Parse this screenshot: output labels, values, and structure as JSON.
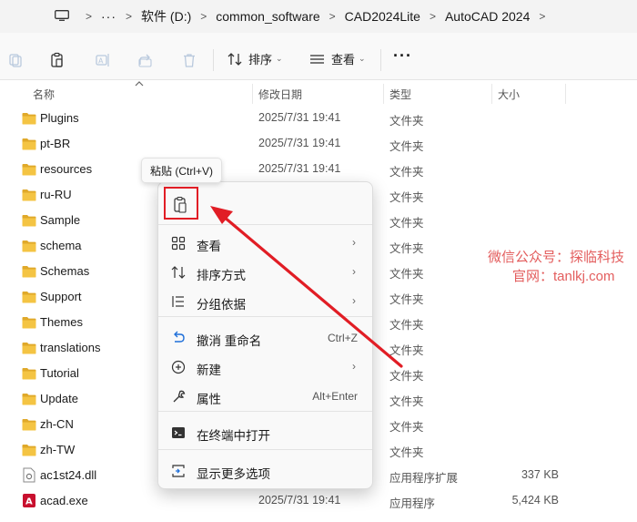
{
  "breadcrumb": {
    "overflow": "···",
    "items": [
      "软件 (D:)",
      "common_software",
      "CAD2024Lite",
      "AutoCAD 2024"
    ],
    "sep": ">"
  },
  "toolbar": {
    "sort_label": "排序",
    "view_label": "查看",
    "more_label": "···",
    "caret": "⌄"
  },
  "columns": {
    "name": "名称",
    "date": "修改日期",
    "type": "类型",
    "size": "大小"
  },
  "files": [
    {
      "name": "Plugins",
      "date": "2025/7/31 19:41",
      "type": "文件夹",
      "size": "",
      "kind": "folder"
    },
    {
      "name": "pt-BR",
      "date": "2025/7/31 19:41",
      "type": "文件夹",
      "size": "",
      "kind": "folder"
    },
    {
      "name": "resources",
      "date": "2025/7/31 19:41",
      "type": "文件夹",
      "size": "",
      "kind": "folder"
    },
    {
      "name": "ru-RU",
      "date": "",
      "type": "文件夹",
      "size": "",
      "kind": "folder"
    },
    {
      "name": "Sample",
      "date": "",
      "type": "文件夹",
      "size": "",
      "kind": "folder"
    },
    {
      "name": "schema",
      "date": "",
      "type": "文件夹",
      "size": "",
      "kind": "folder"
    },
    {
      "name": "Schemas",
      "date": "",
      "type": "文件夹",
      "size": "",
      "kind": "folder"
    },
    {
      "name": "Support",
      "date": "",
      "type": "文件夹",
      "size": "",
      "kind": "folder"
    },
    {
      "name": "Themes",
      "date": "",
      "type": "文件夹",
      "size": "",
      "kind": "folder"
    },
    {
      "name": "translations",
      "date": "",
      "type": "文件夹",
      "size": "",
      "kind": "folder"
    },
    {
      "name": "Tutorial",
      "date": "",
      "type": "文件夹",
      "size": "",
      "kind": "folder"
    },
    {
      "name": "Update",
      "date": "",
      "type": "文件夹",
      "size": "",
      "kind": "folder"
    },
    {
      "name": "zh-CN",
      "date": "",
      "type": "文件夹",
      "size": "",
      "kind": "folder"
    },
    {
      "name": "zh-TW",
      "date": "",
      "type": "文件夹",
      "size": "",
      "kind": "folder"
    },
    {
      "name": "ac1st24.dll",
      "date": "",
      "type": "应用程序扩展",
      "size": "337 KB",
      "kind": "dll"
    },
    {
      "name": "acad.exe",
      "date": "2025/7/31 19:41",
      "type": "应用程序",
      "size": "5,424 KB",
      "kind": "exe"
    }
  ],
  "tooltip": "粘贴 (Ctrl+V)",
  "context_menu": {
    "items": [
      {
        "label": "查看",
        "shortcut": "",
        "submenu": true,
        "icon": "grid-view-icon"
      },
      {
        "label": "排序方式",
        "shortcut": "",
        "submenu": true,
        "icon": "sort-icon"
      },
      {
        "label": "分组依据",
        "shortcut": "",
        "submenu": true,
        "icon": "group-by-icon"
      },
      {
        "label": "撤消 重命名",
        "shortcut": "Ctrl+Z",
        "submenu": false,
        "icon": "undo-icon"
      },
      {
        "label": "新建",
        "shortcut": "",
        "submenu": true,
        "icon": "new-icon"
      },
      {
        "label": "属性",
        "shortcut": "Alt+Enter",
        "submenu": false,
        "icon": "properties-wrench-icon"
      },
      {
        "label": "在终端中打开",
        "shortcut": "",
        "submenu": false,
        "icon": "terminal-icon"
      },
      {
        "label": "显示更多选项",
        "shortcut": "",
        "submenu": false,
        "icon": "more-options-icon"
      }
    ],
    "chevron": "›"
  },
  "watermark": {
    "line1": "微信公众号：探临科技",
    "line2": "官网：tanlkj.com"
  },
  "colors": {
    "accent_red": "#e11d25",
    "folder_yellow": "#f4c443",
    "folder_dark": "#e0a92a"
  }
}
